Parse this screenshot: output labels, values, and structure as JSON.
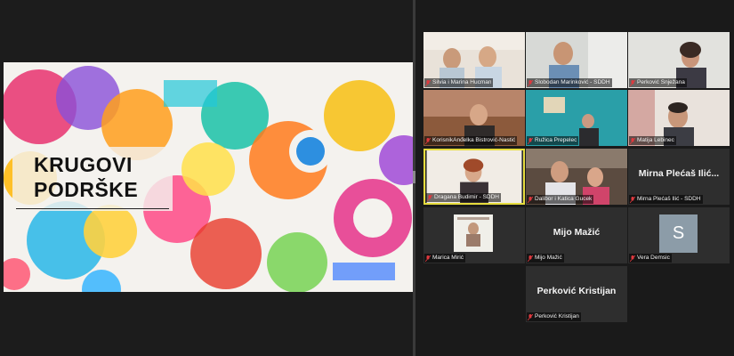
{
  "slide": {
    "title_line1": "KRUGOVI",
    "title_line2": "PODRŠKE"
  },
  "participants": [
    {
      "name": "Silvia i Marina Hucman",
      "muted": true
    },
    {
      "name": "Slobodan Marinković - SDDH",
      "muted": true
    },
    {
      "name": "Perković Snježana",
      "muted": true
    },
    {
      "name": "KorisnikAnđelka Bistrović-Nastić",
      "muted": true
    },
    {
      "name": "Ružica Prepelec",
      "muted": true
    },
    {
      "name": "Matija Lebinec",
      "muted": true
    },
    {
      "name": "Dragana Budimir - SDDH",
      "muted": true,
      "active_speaker": true
    },
    {
      "name": "Dalibor i Katica Gucek",
      "muted": true
    },
    {
      "name": "Mirna Plećaš Ilić - SDDH",
      "display_name": "Mirna Plećaš Ilić...",
      "muted": true,
      "video": false
    },
    {
      "name": "Marica Mirić",
      "muted": true
    },
    {
      "name": "Mijo Mažić",
      "display_name": "Mijo Mažić",
      "muted": true,
      "video": false
    },
    {
      "name": "Vera Demsic",
      "avatar_letter": "S",
      "muted": true,
      "video": false
    },
    {
      "name": "Perković Kristijan",
      "display_name": "Perković Kristijan",
      "muted": true,
      "video": false
    }
  ],
  "colors": {
    "background": "#1a1a1a",
    "tile": "#2e2e2e",
    "active_border": "#e6dc3e",
    "mute_icon": "#e0393e"
  }
}
